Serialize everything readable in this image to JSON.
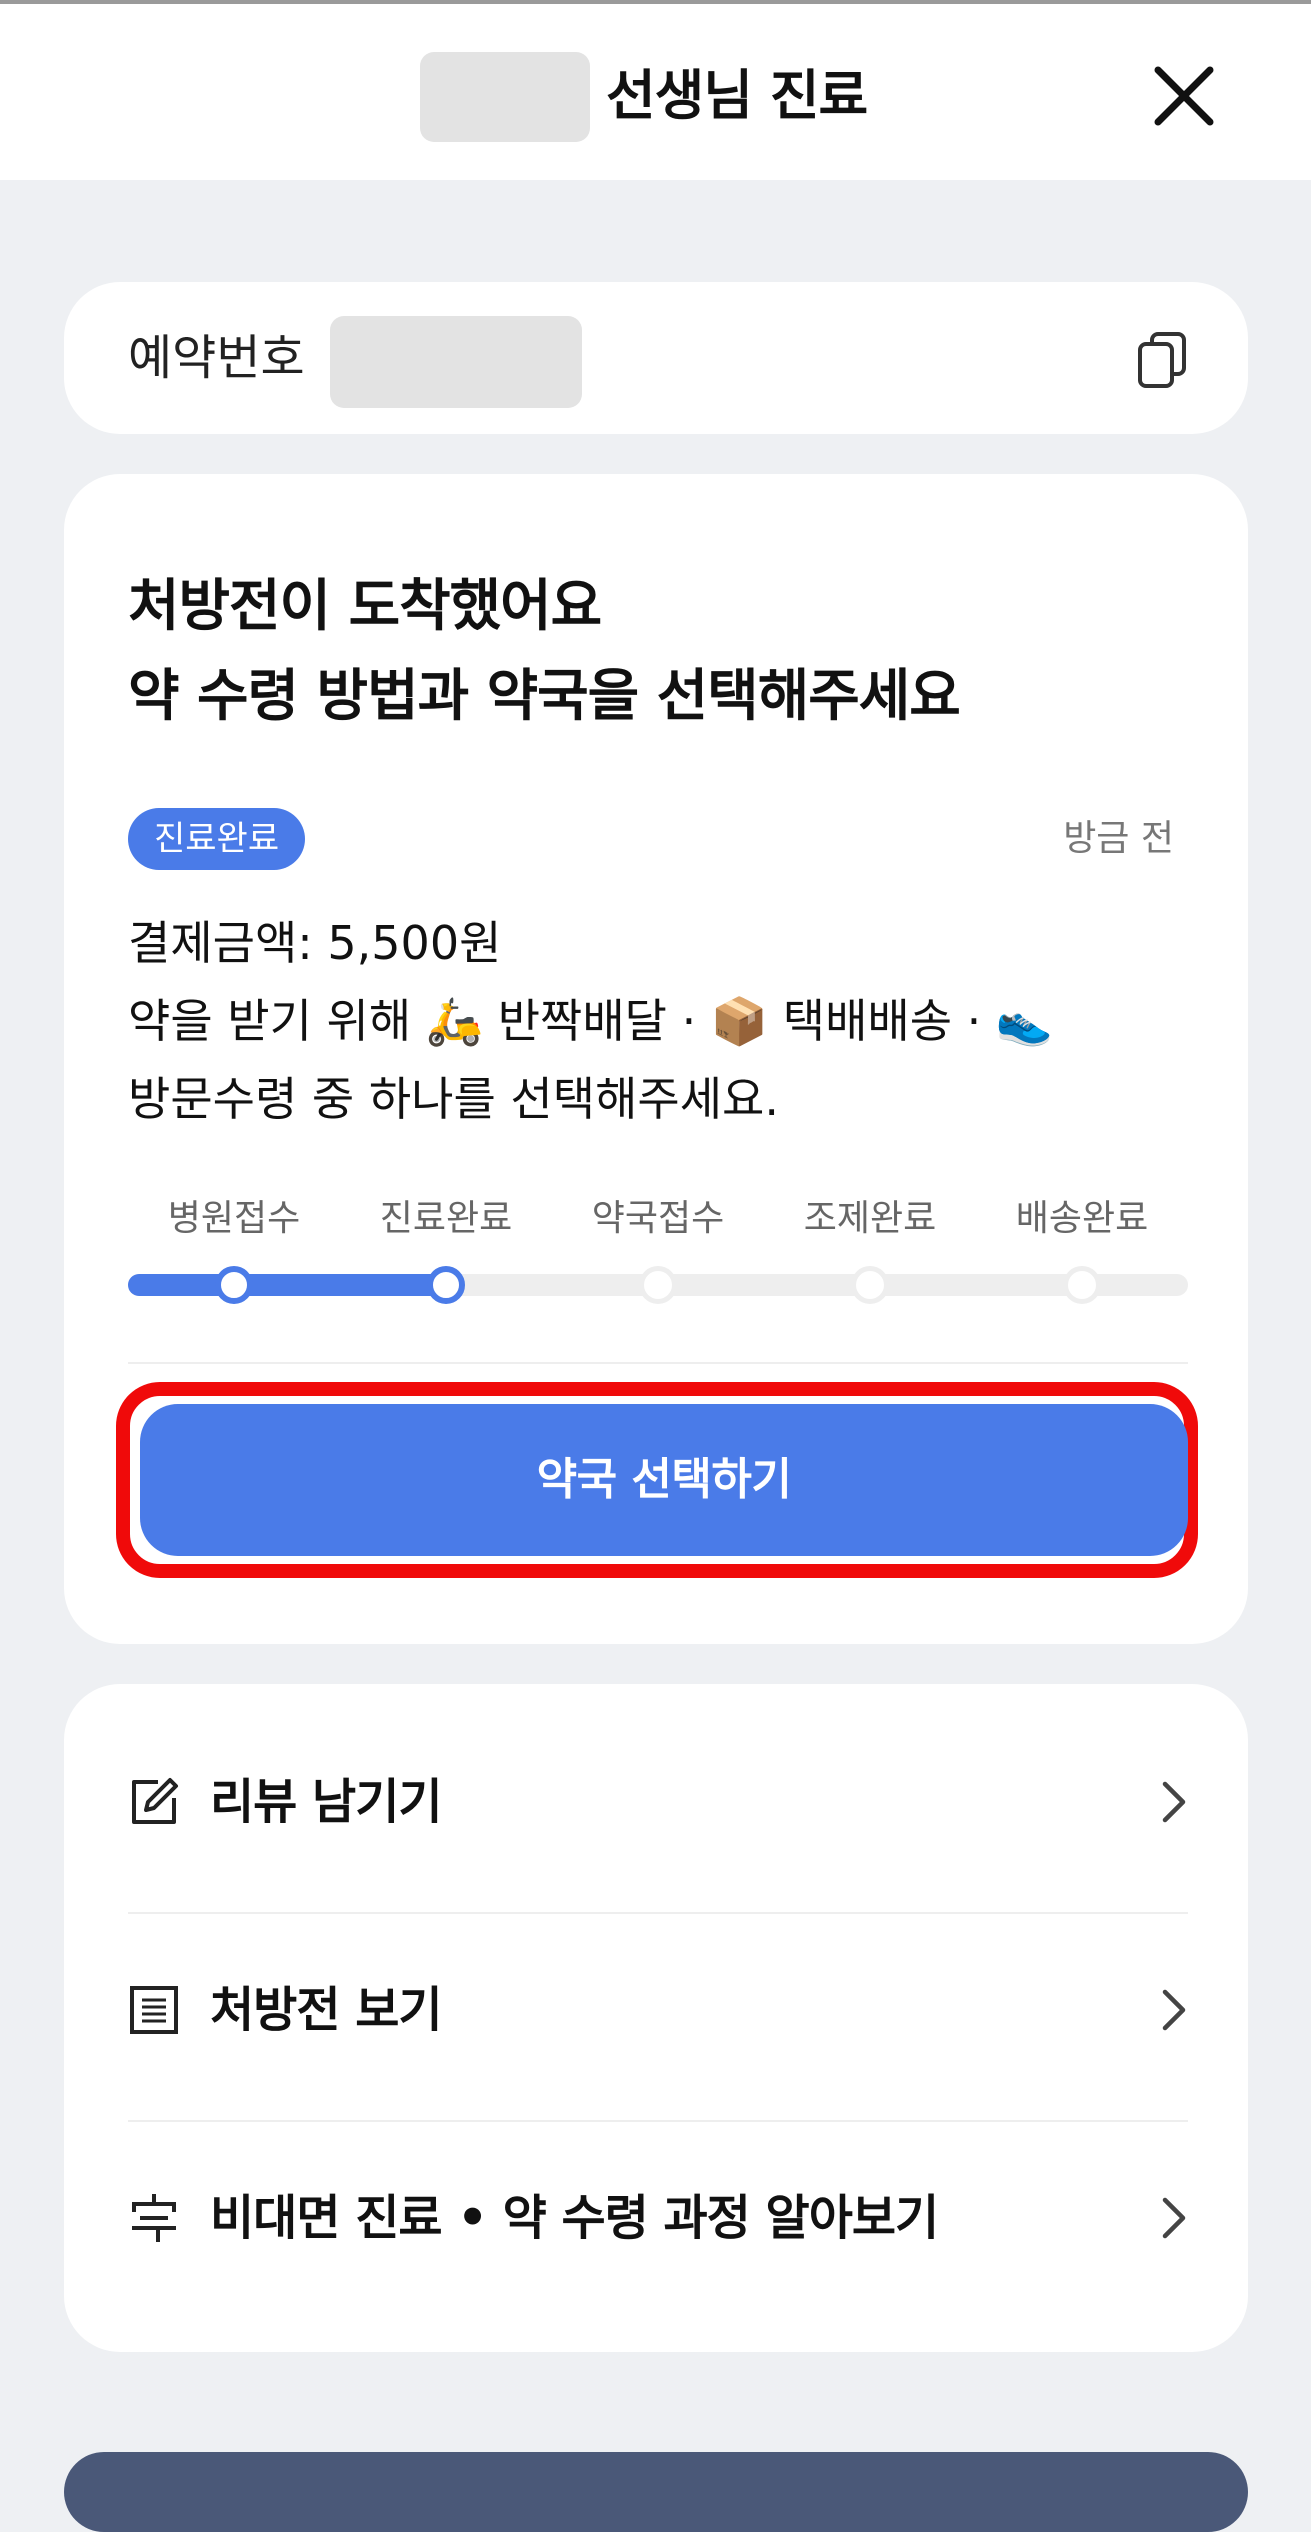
{
  "header": {
    "title": "선생님 진료",
    "close_icon": "close-icon"
  },
  "reservation": {
    "label": "예약번호",
    "copy_icon": "copy-icon"
  },
  "status_card": {
    "headline_line1": "처방전이 도착했어요",
    "headline_line2": "약 수령 방법과 약국을 선택해주세요",
    "badge": "진료완료",
    "time_ago": "방금 전",
    "payment": "결제금액: 5,500원",
    "line2_prefix": "약을 받기 위해 ",
    "delivery_emoji": "🛵",
    "delivery_label": " 반짝배달 · ",
    "parcel_emoji": "📦",
    "parcel_label": " 택배배송 · ",
    "visit_emoji": "👟",
    "line3": "방문수령 중 하나를 선택해주세요.",
    "steps": [
      {
        "label": "병원접수",
        "done": true
      },
      {
        "label": "진료완료",
        "done": true
      },
      {
        "label": "약국접수",
        "done": false
      },
      {
        "label": "조제완료",
        "done": false
      },
      {
        "label": "배송완료",
        "done": false
      }
    ],
    "progress_completed_steps": 2,
    "cta_label": "약국 선택하기",
    "accent_color": "#4a7be8",
    "highlight_color": "#f00a0a"
  },
  "links": [
    {
      "label": "리뷰 남기기",
      "icon": "edit-icon"
    },
    {
      "label": "처방전 보기",
      "icon": "receipt-icon"
    },
    {
      "label": "비대면 진료 • 약 수령 과정 알아보기",
      "icon": "guide-icon"
    }
  ]
}
